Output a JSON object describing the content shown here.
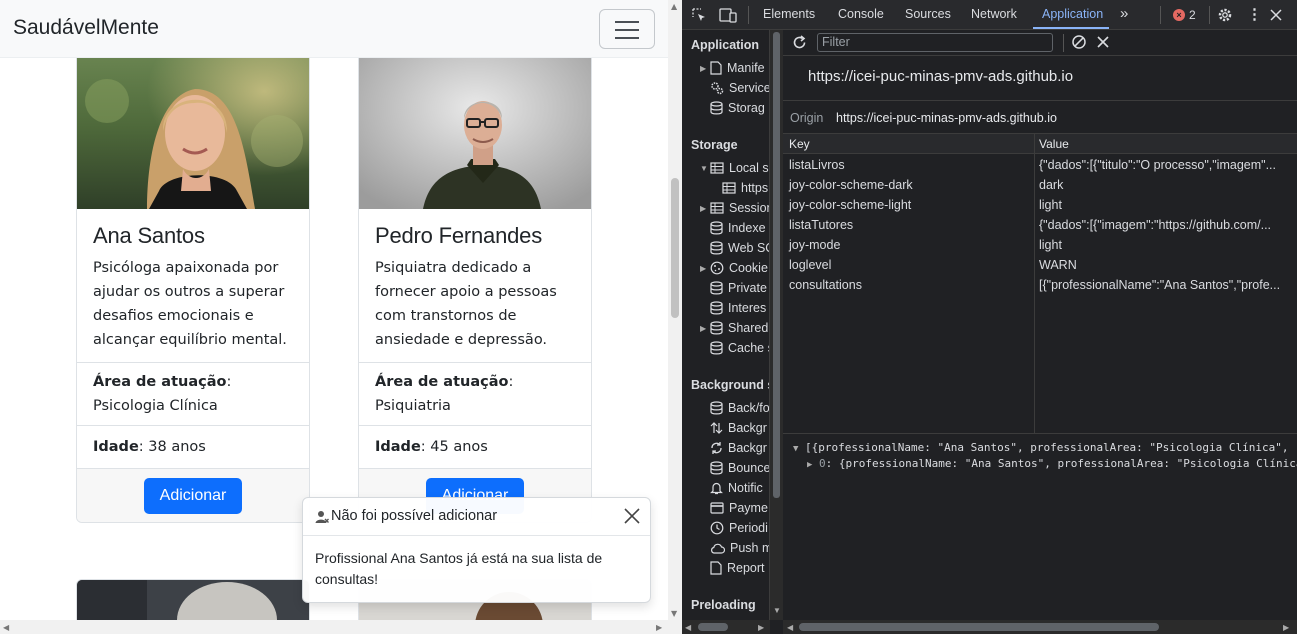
{
  "page": {
    "brand": "SaudávelMente",
    "cards": [
      {
        "name": "Ana Santos",
        "description": "Psicóloga apaixonada por ajudar os outros a superar desafios emocionais e alcançar equilíbrio mental.",
        "area_label": "Área de atuação",
        "area": "Psicologia Clínica",
        "age_label": "Idade",
        "age": "38 anos",
        "button": "Adicionar"
      },
      {
        "name": "Pedro Fernandes",
        "description": "Psiquiatra dedicado a fornecer apoio a pessoas com transtornos de ansiedade e depressão.",
        "area_label": "Área de atuação",
        "area": "Psiquiatria",
        "age_label": "Idade",
        "age": "45 anos",
        "button": "Adicionar"
      }
    ],
    "toast": {
      "title": "Não foi possível adicionar",
      "message": "Profissional Ana Santos já está na sua lista de consultas!"
    }
  },
  "devtools": {
    "tabs": [
      "Elements",
      "Console",
      "Sources",
      "Network",
      "Application"
    ],
    "active_tab": "Application",
    "error_count": "2",
    "sidebar": {
      "application_header": "Application",
      "application_items": [
        "Manife",
        "Service",
        "Storag"
      ],
      "storage_header": "Storage",
      "storage_items": [
        "Local s",
        "https",
        "Session",
        "Indexe",
        "Web SC",
        "Cookie",
        "Private",
        "Interes",
        "Shared",
        "Cache s"
      ],
      "background_header": "Background se",
      "background_items": [
        "Back/fo",
        "Backgr",
        "Backgr",
        "Bounce",
        "Notific",
        "Payme",
        "Periodi",
        "Push m",
        "Report"
      ],
      "preloading_header": "Preloading"
    },
    "filter_placeholder": "Filter",
    "origin_url": "https://icei-puc-minas-pmv-ads.github.io",
    "origin_label": "Origin",
    "origin_value": "https://icei-puc-minas-pmv-ads.github.io",
    "table": {
      "key_header": "Key",
      "value_header": "Value",
      "rows": [
        {
          "key": "listaLivros",
          "value": "{\"dados\":[{\"titulo\":\"O processo\",\"imagem\"..."
        },
        {
          "key": "joy-color-scheme-dark",
          "value": "dark"
        },
        {
          "key": "joy-color-scheme-light",
          "value": "light"
        },
        {
          "key": "listaTutores",
          "value": "{\"dados\":[{\"imagem\":\"https://github.com/..."
        },
        {
          "key": "joy-mode",
          "value": "light"
        },
        {
          "key": "loglevel",
          "value": "WARN"
        },
        {
          "key": "consultations",
          "value": "[{\"professionalName\":\"Ana Santos\",\"profe..."
        }
      ]
    },
    "preview": {
      "line1": "[{professionalName: \"Ana Santos\", professionalArea: \"Psicologia Clínica\",",
      "line2_key": "0",
      "line2_rest": ": {professionalName: \"Ana Santos\", professionalArea: \"Psicologia Clínica\","
    }
  }
}
